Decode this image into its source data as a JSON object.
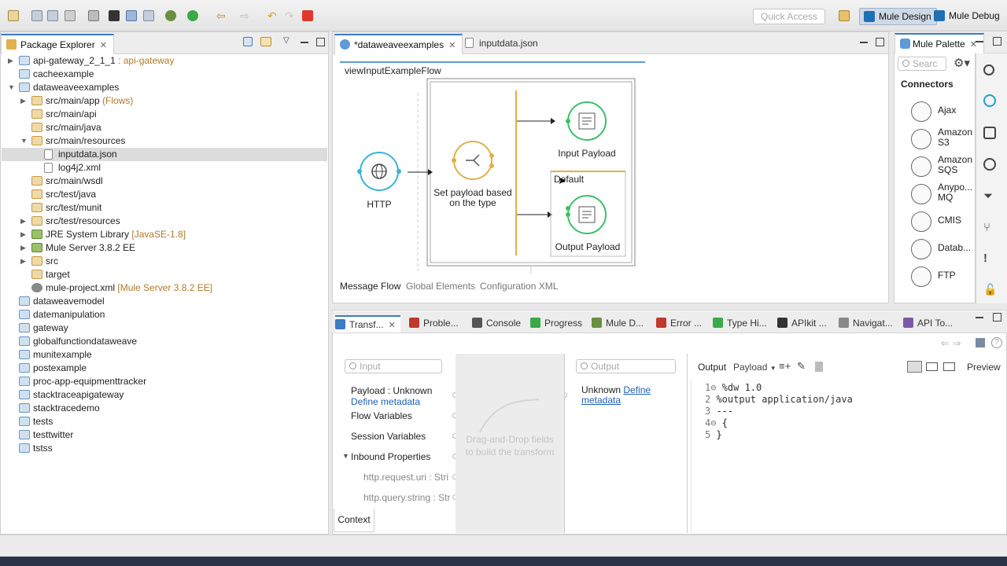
{
  "toolbar": {
    "quick_access_placeholder": "Quick Access",
    "perspectives": [
      {
        "label": "Mule Design",
        "active": true
      },
      {
        "label": "Mule Debug",
        "active": false
      }
    ]
  },
  "explorer": {
    "tab_label": "Package Explorer",
    "items": [
      {
        "label": "api-gateway_2_1_1",
        "decoration": " : api-gateway",
        "icon": "project-icon",
        "expanded": false,
        "indent": 0
      },
      {
        "label": "cacheexample",
        "decoration": "",
        "icon": "project-icon",
        "expanded": null,
        "indent": 0
      },
      {
        "label": "dataweaveexamples",
        "decoration": "",
        "icon": "project-icon",
        "expanded": true,
        "indent": 0
      },
      {
        "label": "src/main/app",
        "decoration": " (Flows)",
        "icon": "package-folder-icon",
        "expanded": false,
        "indent": 1
      },
      {
        "label": "src/main/api",
        "decoration": "",
        "icon": "package-folder-icon",
        "expanded": null,
        "indent": 1
      },
      {
        "label": "src/main/java",
        "decoration": "",
        "icon": "package-folder-icon",
        "expanded": null,
        "indent": 1
      },
      {
        "label": "src/main/resources",
        "decoration": "",
        "icon": "package-folder-icon",
        "expanded": true,
        "indent": 1
      },
      {
        "label": "inputdata.json",
        "decoration": "",
        "icon": "json-file-icon",
        "expanded": null,
        "indent": 2,
        "selected": true
      },
      {
        "label": "log4j2.xml",
        "decoration": "",
        "icon": "xml-file-icon",
        "expanded": null,
        "indent": 2
      },
      {
        "label": "src/main/wsdl",
        "decoration": "",
        "icon": "package-folder-icon",
        "expanded": null,
        "indent": 1
      },
      {
        "label": "src/test/java",
        "decoration": "",
        "icon": "package-folder-icon",
        "expanded": null,
        "indent": 1
      },
      {
        "label": "src/test/munit",
        "decoration": "",
        "icon": "package-folder-icon",
        "expanded": null,
        "indent": 1
      },
      {
        "label": "src/test/resources",
        "decoration": "",
        "icon": "package-folder-icon",
        "expanded": false,
        "indent": 1
      },
      {
        "label": "JRE System Library",
        "decoration": " [JavaSE-1.8]",
        "icon": "library-icon",
        "expanded": false,
        "indent": 1
      },
      {
        "label": "Mule Server 3.8.2 EE",
        "decoration": "",
        "icon": "library-icon",
        "expanded": false,
        "indent": 1
      },
      {
        "label": "src",
        "decoration": "",
        "icon": "package-folder-icon",
        "expanded": false,
        "indent": 1
      },
      {
        "label": "target",
        "decoration": "",
        "icon": "package-folder-icon",
        "expanded": null,
        "indent": 1
      },
      {
        "label": "mule-project.xml",
        "decoration": " [Mule Server 3.8.2 EE]",
        "icon": "gear-file-icon",
        "expanded": null,
        "indent": 1
      },
      {
        "label": "dataweavemodel",
        "decoration": "",
        "icon": "project-icon",
        "expanded": null,
        "indent": 0
      },
      {
        "label": "datemanipulation",
        "decoration": "",
        "icon": "project-icon",
        "expanded": null,
        "indent": 0
      },
      {
        "label": "gateway",
        "decoration": "",
        "icon": "project-icon",
        "expanded": null,
        "indent": 0
      },
      {
        "label": "globalfunctiondataweave",
        "decoration": "",
        "icon": "project-icon",
        "expanded": null,
        "indent": 0
      },
      {
        "label": "munitexample",
        "decoration": "",
        "icon": "project-icon",
        "expanded": null,
        "indent": 0
      },
      {
        "label": "postexample",
        "decoration": "",
        "icon": "project-icon",
        "expanded": null,
        "indent": 0
      },
      {
        "label": "proc-app-equipmenttracker",
        "decoration": "",
        "icon": "project-icon",
        "expanded": null,
        "indent": 0
      },
      {
        "label": "stacktraceapigateway",
        "decoration": "",
        "icon": "project-icon",
        "expanded": null,
        "indent": 0
      },
      {
        "label": "stacktracedemo",
        "decoration": "",
        "icon": "project-icon",
        "expanded": null,
        "indent": 0
      },
      {
        "label": "tests",
        "decoration": "",
        "icon": "project-icon",
        "expanded": null,
        "indent": 0
      },
      {
        "label": "testtwitter",
        "decoration": "",
        "icon": "project-icon",
        "expanded": null,
        "indent": 0
      },
      {
        "label": "tstss",
        "decoration": "",
        "icon": "project-icon",
        "expanded": null,
        "indent": 0
      }
    ]
  },
  "editor": {
    "tabs": [
      {
        "label": "*dataweaveexamples",
        "active": true
      },
      {
        "label": "inputdata.json",
        "active": false
      }
    ],
    "flow_name": "viewInputExampleFlow",
    "nodes": {
      "http": "HTTP",
      "choice": "Set payload based on the type",
      "input_payload": "Input Payload",
      "default_label": "Default",
      "output_payload": "Output Payload"
    },
    "bottom_tabs": [
      "Message Flow",
      "Global Elements",
      "Configuration XML"
    ]
  },
  "bottom_panel": {
    "tabs": [
      "Transf...",
      "Proble...",
      "Console",
      "Progress",
      "Mule D...",
      "Error ...",
      "Type Hi...",
      "APIkit ...",
      "Navigat...",
      "API To..."
    ],
    "input_placeholder": "Input",
    "output_placeholder": "Output",
    "input_tree": {
      "payload_label": "Payload : Unknown",
      "define_metadata": "Define metadata",
      "flow_variables": "Flow Variables",
      "session_variables": "Session Variables",
      "inbound_properties": "Inbound Properties",
      "props": [
        "http.request.uri : Stri",
        "http.query.string : Str"
      ]
    },
    "drag_hint": "Drag-and-Drop fields to build the transform",
    "context_tab": "Context",
    "output_unknown": "Unknown",
    "output_define": "Define",
    "output_metadata": "metadata",
    "output_label": "Output",
    "payload_select": "Payload",
    "preview_label": "Preview",
    "code_lines": [
      {
        "n": "1",
        "text": "%dw 1.0",
        "fold": true
      },
      {
        "n": "2",
        "text": "%output application/java",
        "fold": false
      },
      {
        "n": "3",
        "text": "---",
        "fold": false
      },
      {
        "n": "4",
        "text": "{",
        "fold": true
      },
      {
        "n": "5",
        "text": "}",
        "fold": false
      }
    ]
  },
  "palette": {
    "tab_label": "Mule Palette",
    "search_placeholder": "Searc",
    "section": "Connectors",
    "items": [
      "Ajax",
      "Amazon S3",
      "Amazon SQS",
      "Anypo... MQ",
      "CMIS",
      "Datab...",
      "FTP"
    ]
  }
}
